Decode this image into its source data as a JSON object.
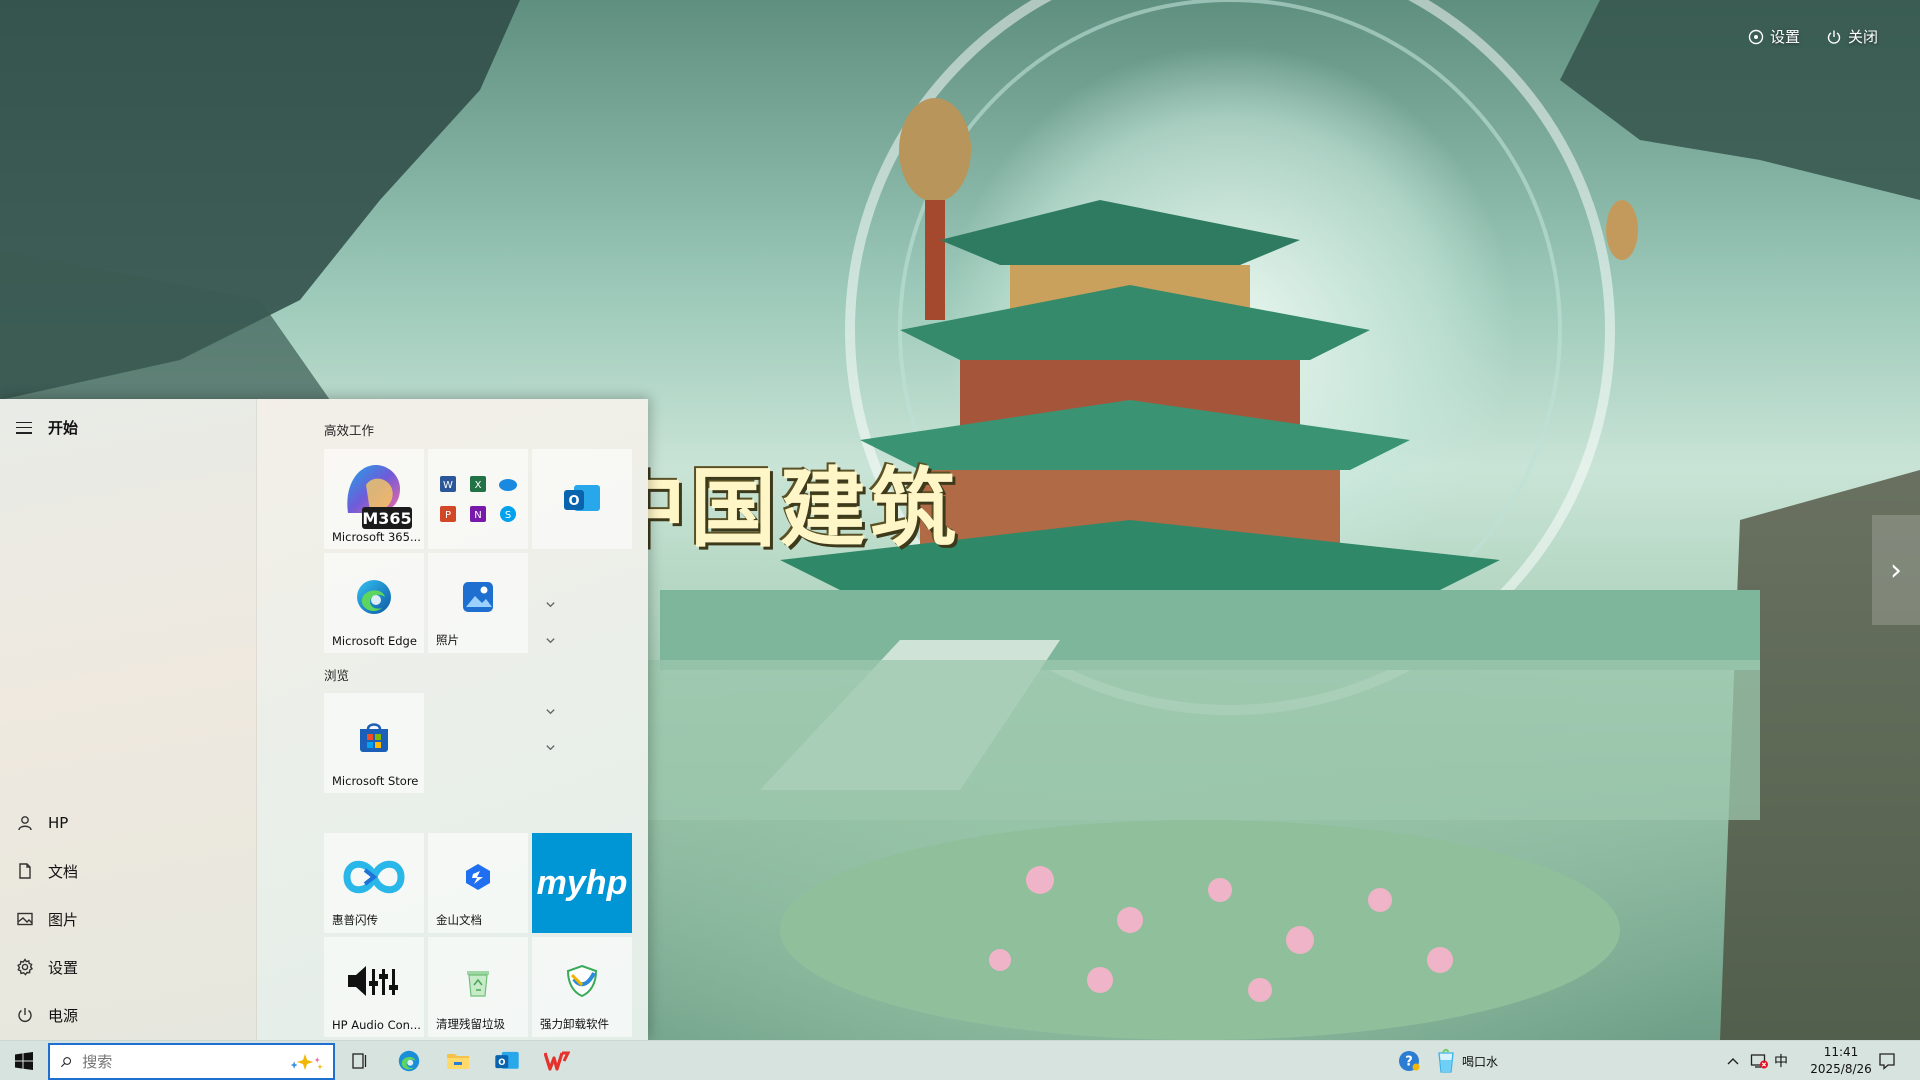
{
  "spotlight": {
    "settings_label": "设置",
    "close_label": "关闭",
    "caption": "中国建筑"
  },
  "start_menu": {
    "header_label": "开始",
    "left_items": [
      {
        "label": "HP",
        "icon": "user-icon"
      },
      {
        "label": "文档",
        "icon": "document-icon"
      },
      {
        "label": "图片",
        "icon": "picture-icon"
      },
      {
        "label": "设置",
        "icon": "gear-icon"
      },
      {
        "label": "电源",
        "icon": "power-icon"
      }
    ],
    "groups": [
      {
        "title": "高效工作"
      },
      {
        "title": "浏览"
      }
    ],
    "tiles": {
      "m365": {
        "label": "Microsoft 365...",
        "badge": "M365"
      },
      "office_apps": {
        "label": ""
      },
      "outlook": {
        "label": ""
      },
      "edge": {
        "label": "Microsoft Edge"
      },
      "photos": {
        "label": "照片"
      },
      "store": {
        "label": "Microsoft Store"
      },
      "hp_flash": {
        "label": "惠普闪传"
      },
      "kingsoft_docs": {
        "label": "金山文档"
      },
      "myhp": {
        "label": "",
        "logo_text": "myhp"
      },
      "hp_audio": {
        "label": "HP Audio Con..."
      },
      "cleaner": {
        "label": "清理残留垃圾"
      },
      "uninstaller": {
        "label": "强力卸载软件"
      }
    }
  },
  "taskbar": {
    "search_placeholder": "搜索",
    "pinned": [
      "windows-start",
      "task-view",
      "edge",
      "file-explorer",
      "outlook",
      "wps"
    ],
    "tray_app_label": "喝口水",
    "ime_label": "中",
    "time": "11:41",
    "date": "2025/8/26"
  },
  "colors": {
    "accent": "#1e6fd0",
    "myhp_blue": "#0096d6",
    "taskbar_bg": "#d6e3de"
  }
}
